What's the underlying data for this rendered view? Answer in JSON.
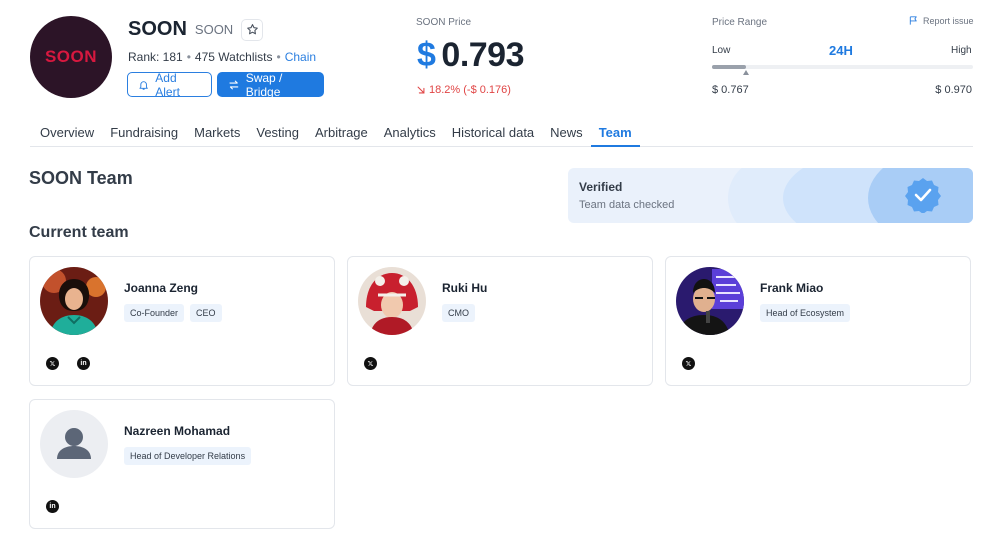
{
  "coin": {
    "logo_text": "SOON",
    "name": "SOON",
    "symbol": "SOON",
    "rank": "Rank: 181",
    "watchlists": "475 Watchlists",
    "chain_link": "Chain"
  },
  "actions": {
    "alert_label": "Add Alert",
    "swap_label": "Swap / Bridge"
  },
  "price": {
    "label": "SOON Price",
    "currency": "$",
    "value": "0.793",
    "change": "18.2% (-$ 0.176)",
    "change_direction": "down",
    "change_color": "#e04545"
  },
  "range": {
    "label": "Price Range",
    "report_label": "Report issue",
    "low_label": "Low",
    "timeframe": "24H",
    "high_label": "High",
    "low_value": "$ 0.767",
    "high_value": "$ 0.970",
    "current_position_fraction": 0.13
  },
  "tabs": [
    {
      "label": "Overview",
      "active": false
    },
    {
      "label": "Fundraising",
      "active": false
    },
    {
      "label": "Markets",
      "active": false
    },
    {
      "label": "Vesting",
      "active": false
    },
    {
      "label": "Arbitrage",
      "active": false
    },
    {
      "label": "Analytics",
      "active": false
    },
    {
      "label": "Historical data",
      "active": false
    },
    {
      "label": "News",
      "active": false
    },
    {
      "label": "Team",
      "active": true
    }
  ],
  "team": {
    "title": "SOON Team",
    "verified_title": "Verified",
    "verified_subtitle": "Team data checked",
    "current_title": "Current team",
    "members": [
      {
        "name": "Joanna Zeng",
        "roles": [
          "Co-Founder",
          "CEO"
        ],
        "socials": [
          "x-icon",
          "linkedin-icon"
        ]
      },
      {
        "name": "Ruki Hu",
        "roles": [
          "CMO"
        ],
        "socials": [
          "x-icon"
        ]
      },
      {
        "name": "Frank Miao",
        "roles": [
          "Head of Ecosystem"
        ],
        "socials": [
          "x-icon"
        ]
      },
      {
        "name": "Nazreen Mohamad",
        "roles": [
          "Head of Developer Relations"
        ],
        "socials": [
          "linkedin-icon"
        ]
      }
    ]
  },
  "colors": {
    "accent": "#1f7ae0",
    "negative": "#e04545",
    "logo_bg": "#2c1427",
    "logo_text": "#d7183f"
  }
}
